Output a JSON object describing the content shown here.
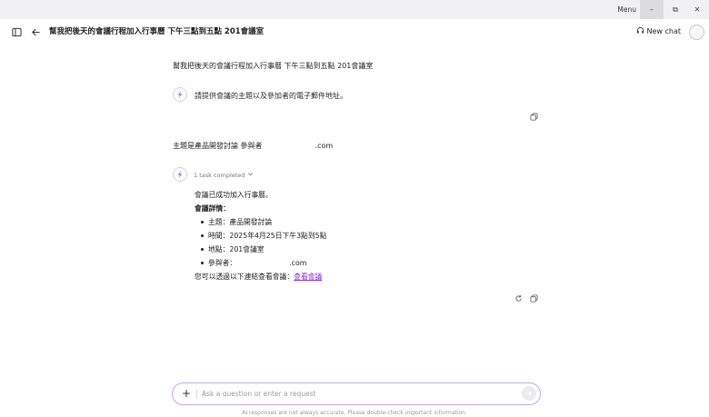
{
  "window": {
    "menu_label": "Menu",
    "minimize_glyph": "–",
    "maximize_glyph": "⧉",
    "close_glyph": "✕"
  },
  "header": {
    "title": "幫我把後天的會議行程加入行事曆 下午三點到五點 201會議室",
    "new_chat_label": "New chat"
  },
  "conversation": {
    "user_message_1": "幫我把後天的會議行程加入行事曆 下午三點到五點 201會議室",
    "bot_message_1": "請提供會議的主題以及參加者的電子郵件地址。",
    "user_message_2_prefix": "主題是產品開發討論 參與者",
    "user_message_2_suffix": ".com",
    "task_status": "1 task completed",
    "response": {
      "intro": "會議已成功加入行事曆。",
      "details_heading": "會議詳情：",
      "items": [
        {
          "text": "主題：產品開發討論"
        },
        {
          "text": "時間：2025年4月25日下午3點到5點"
        },
        {
          "text": "地點：201會議室"
        },
        {
          "text": "參與者：",
          "suffix": ".com"
        }
      ],
      "link_prefix": "您可以透過以下連結查看會議：",
      "link_text": "查看會議"
    }
  },
  "composer": {
    "placeholder": "Ask a question or enter a request",
    "disclaimer": "AI responses are not always accurate. Please double-check important information."
  },
  "colors": {
    "accent": "#8a2be2",
    "input_border": "#c7a6f0",
    "titlebar_bg": "#f1f1f3"
  },
  "icons": {
    "sidebar": "sidebar-toggle-icon",
    "back": "back-arrow-icon",
    "new_chat": "headset-icon",
    "bot": "bot-logo-icon",
    "copy": "copy-icon",
    "retry": "retry-icon",
    "expand": "chevron-down-icon",
    "add": "plus-icon",
    "send": "send-icon"
  }
}
